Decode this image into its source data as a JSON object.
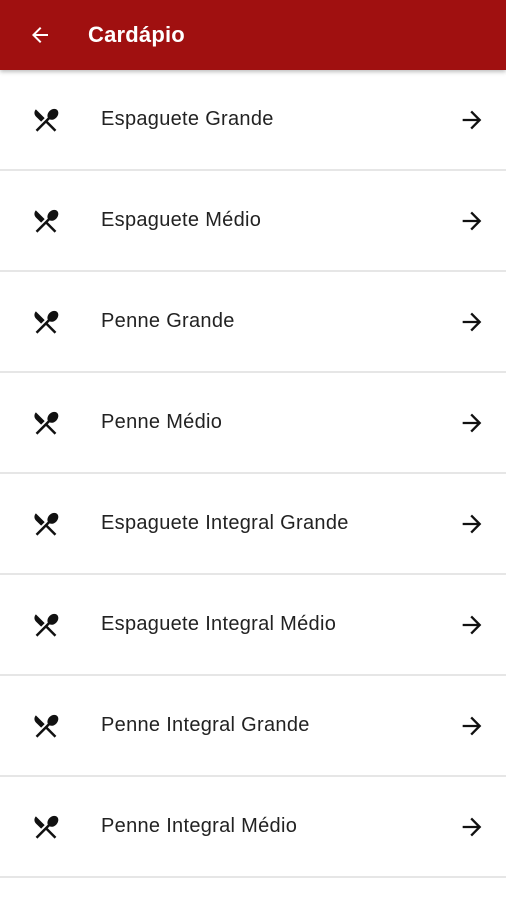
{
  "header": {
    "title": "Cardápio",
    "back_icon": "arrow-left-icon",
    "background_color": "#a01010"
  },
  "menu": {
    "item_icon": "restaurant-fork-spoon-icon",
    "arrow_icon": "arrow-right-icon",
    "items": [
      {
        "label": "Espaguete Grande"
      },
      {
        "label": "Espaguete Médio"
      },
      {
        "label": "Penne Grande"
      },
      {
        "label": "Penne Médio"
      },
      {
        "label": "Espaguete Integral Grande"
      },
      {
        "label": "Espaguete Integral Médio"
      },
      {
        "label": "Penne Integral Grande"
      },
      {
        "label": "Penne Integral Médio"
      }
    ]
  }
}
